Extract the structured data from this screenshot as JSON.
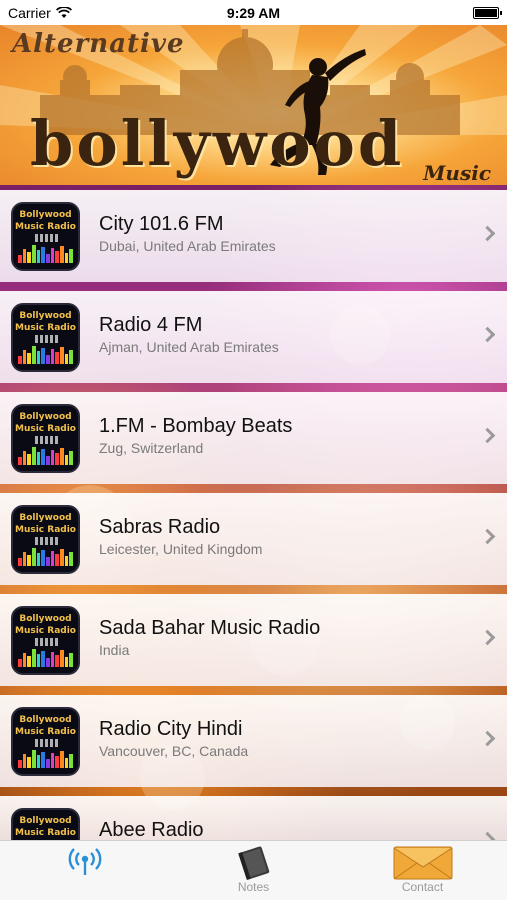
{
  "status_bar": {
    "carrier": "Carrier",
    "time": "9:29 AM"
  },
  "banner": {
    "title_top": "Alternative",
    "title_main": "bollywood",
    "title_sub": "Music"
  },
  "stations": [
    {
      "name": "City 101.6 FM",
      "location": "Dubai, United Arab Emirates",
      "thumb_line1": "Bollywood",
      "thumb_line2": "Music Radio"
    },
    {
      "name": "Radio 4 FM",
      "location": "Ajman, United Arab Emirates",
      "thumb_line1": "Bollywood",
      "thumb_line2": "Music Radio"
    },
    {
      "name": "1.FM - Bombay Beats",
      "location": "Zug, Switzerland",
      "thumb_line1": "Bollywood",
      "thumb_line2": "Music Radio"
    },
    {
      "name": "Sabras Radio",
      "location": "Leicester, United Kingdom",
      "thumb_line1": "Bollywood",
      "thumb_line2": "Music Radio"
    },
    {
      "name": "Sada Bahar Music Radio",
      "location": "India",
      "thumb_line1": "Bollywood",
      "thumb_line2": "Music Radio"
    },
    {
      "name": "Radio City Hindi",
      "location": "Vancouver, BC, Canada",
      "thumb_line1": "Bollywood",
      "thumb_line2": "Music Radio"
    },
    {
      "name": "Abee Radio",
      "location": "",
      "thumb_line1": "Bollywood",
      "thumb_line2": "Music Radio"
    }
  ],
  "tabs": [
    {
      "label": "",
      "icon": "radio-signal-icon"
    },
    {
      "label": "Notes",
      "icon": "notebook-icon"
    },
    {
      "label": "Contact",
      "icon": "envelope-icon"
    }
  ],
  "colors": {
    "tab_active": "#2a8fd6",
    "thumb_text": "#f2c04a",
    "subtitle": "#7a7a7a"
  }
}
